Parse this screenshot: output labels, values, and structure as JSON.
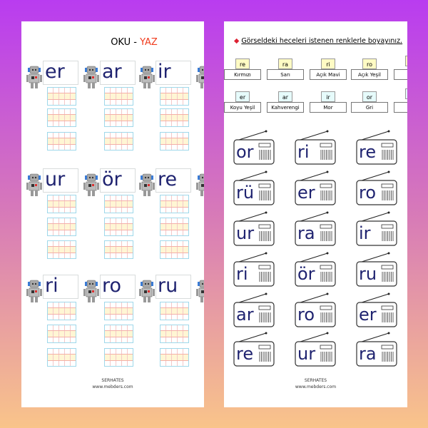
{
  "left_page": {
    "title_part1": "OKU - ",
    "title_part2": "YAZ",
    "words": [
      "er",
      "ar",
      "ir",
      "ur",
      "ör",
      "re",
      "ri",
      "ro",
      "ru"
    ],
    "footer_name": "SERHATES",
    "footer_site": "www.mebders.com"
  },
  "right_page": {
    "instruction": "Görseldeki heceleri istenen renklerle boyayınız.",
    "color_key": [
      {
        "syllable": "re",
        "color": "Kırmızı"
      },
      {
        "syllable": "ra",
        "color": "Sarı"
      },
      {
        "syllable": "ri",
        "color": "Açık Mavi"
      },
      {
        "syllable": "ro",
        "color": "Açık Yeşil"
      },
      {
        "syllable": "",
        "color": "S"
      },
      {
        "syllable": "er",
        "color": "Koyu Yeşil"
      },
      {
        "syllable": "ar",
        "color": "Kahverengi"
      },
      {
        "syllable": "ir",
        "color": "Mor"
      },
      {
        "syllable": "or",
        "color": "Gri"
      },
      {
        "syllable": "",
        "color": "Koy"
      }
    ],
    "radios": [
      "or",
      "ri",
      "re",
      "rü",
      "er",
      "ro",
      "ur",
      "ra",
      "ir",
      "ri",
      "ör",
      "ru",
      "ar",
      "ro",
      "er",
      "re",
      "ur",
      "ra"
    ],
    "footer_name": "SERHATES",
    "footer_site": "www.mebders.com"
  },
  "colors": {
    "bg_top": "#b93cf0",
    "bg_bottom": "#f9c48a",
    "accent": "#f03c1e",
    "letters": "#1f2370"
  }
}
